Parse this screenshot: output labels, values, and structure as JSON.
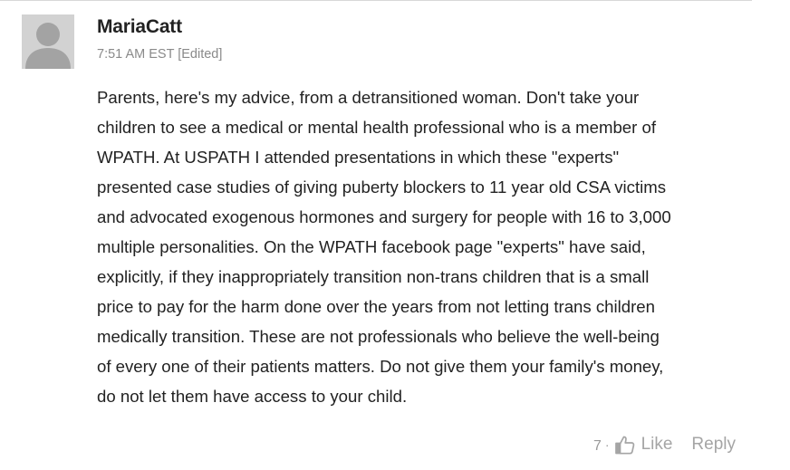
{
  "comment": {
    "author": "MariaCatt",
    "timestamp": "7:51 AM EST",
    "edited_label": "[Edited]",
    "body_lines": [
      "Parents, here's my advice, from a detransitioned woman. Don't take your",
      "children to see a medical or mental health professional who is a member of",
      "WPATH. At USPATH I attended presentations in which these \"experts\"",
      "presented case studies of giving puberty blockers to 11 year old CSA victims",
      "and advocated exogenous hormones and surgery for people with 16 to 3,000",
      "multiple personalities. On the WPATH facebook page \"experts\" have said,",
      "explicitly, if they inappropriately transition non-trans children that is a small",
      "price to pay for the harm done over the years from not letting trans children",
      "medically transition. These are not professionals who believe the well-being",
      "of every one of their patients matters. Do not give them your family's money,",
      "do not let them have access to your child."
    ]
  },
  "actions": {
    "like_count": "7",
    "separator": "·",
    "like_label": "Like",
    "reply_label": "Reply",
    "like_icon": "thumbs-up-icon"
  },
  "colors": {
    "avatar_bg": "#d2d2d2",
    "avatar_fg": "#a3a3a3",
    "muted_text": "#a5a5a5",
    "body_text": "#222222"
  }
}
